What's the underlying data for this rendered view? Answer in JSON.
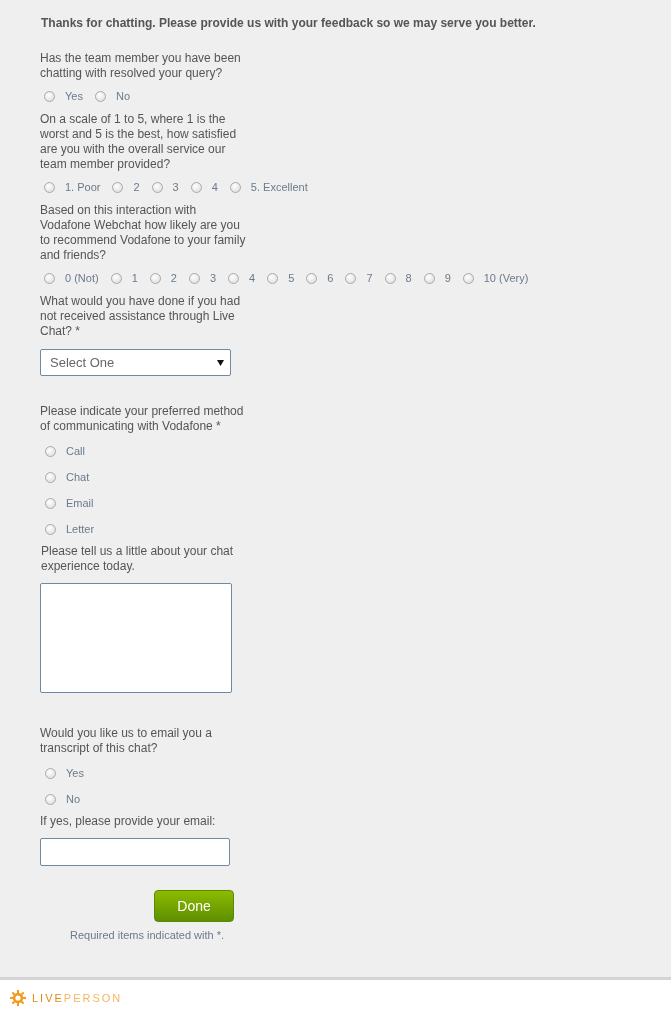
{
  "heading": "Thanks for chatting. Please provide us with your feedback so we may serve you better.",
  "questions": [
    {
      "kind": "inline-radio",
      "text": "Has the team member you have been chatting with resolved your query?",
      "options": [
        {
          "label": "Yes",
          "selected": false
        },
        {
          "label": "No",
          "selected": false
        }
      ]
    },
    {
      "kind": "inline-radio",
      "text": "On a scale of 1 to 5, where 1 is the worst and 5 is the best, how satisfied are you with the overall service our team member provided?",
      "options": [
        {
          "label": "1. Poor",
          "selected": false
        },
        {
          "label": "2",
          "selected": false
        },
        {
          "label": "3",
          "selected": false
        },
        {
          "label": "4",
          "selected": false
        },
        {
          "label": "5. Excellent",
          "selected": false
        }
      ]
    },
    {
      "kind": "inline-radio",
      "text": "Based on this interaction with Vodafone Webchat how likely are you to recommend Vodafone to your family and friends?",
      "options": [
        {
          "label": "0 (Not)",
          "selected": false
        },
        {
          "label": "1",
          "selected": false
        },
        {
          "label": "2",
          "selected": false
        },
        {
          "label": "3",
          "selected": false
        },
        {
          "label": "4",
          "selected": false
        },
        {
          "label": "5",
          "selected": false
        },
        {
          "label": "6",
          "selected": false
        },
        {
          "label": "7",
          "selected": false
        },
        {
          "label": "8",
          "selected": false
        },
        {
          "label": "9",
          "selected": false
        },
        {
          "label": "10 (Very)",
          "selected": false
        }
      ]
    },
    {
      "kind": "select",
      "text": "What would you have done if you had not received assistance through Live Chat? *",
      "value": "Select One"
    },
    {
      "kind": "stacked-radio",
      "text": "Please indicate your preferred method of communicating with Vodafone *",
      "options": [
        {
          "label": "Call",
          "selected": false
        },
        {
          "label": "Chat",
          "selected": false
        },
        {
          "label": "Email",
          "selected": false
        },
        {
          "label": "Letter",
          "selected": false
        }
      ]
    },
    {
      "kind": "textarea",
      "text": "Please tell us a little about your chat experience today."
    },
    {
      "kind": "stacked-radio",
      "text": "Would you like us to email you a transcript of this chat?",
      "options": [
        {
          "label": "Yes",
          "selected": false
        },
        {
          "label": "No",
          "selected": false
        }
      ]
    },
    {
      "kind": "text-input",
      "text": "If yes, please provide your email:"
    }
  ],
  "done_button": "Done",
  "required_note": "Required items indicated with *.",
  "logo": "**LIVE**PERSON"
}
